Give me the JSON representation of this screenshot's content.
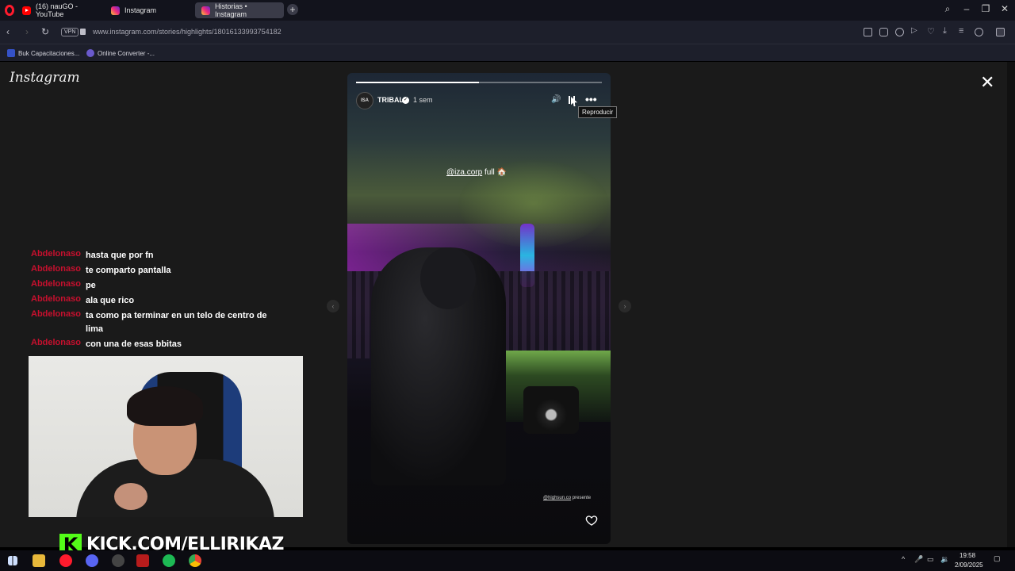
{
  "browser": {
    "tabs": [
      {
        "label": "(16) nauGO - YouTube",
        "icon": "youtube-icon",
        "active": false
      },
      {
        "label": "Instagram",
        "icon": "instagram-icon",
        "active": false
      },
      {
        "label": "Historias • Instagram",
        "icon": "instagram-icon",
        "active": true
      }
    ],
    "vpn_label": "VPN",
    "url": "www.instagram.com/stories/highlights/18016133993754182",
    "bookmarks": [
      {
        "label": "Buk Capacitaciones..."
      },
      {
        "label": "Online Converter -..."
      }
    ]
  },
  "instagram": {
    "logo": "Instagram",
    "story": {
      "avatar_text": "ISA",
      "username": "TRIBAL",
      "time": "1 sem",
      "tooltip": "Reproducir",
      "mention": "@iza.corp",
      "mention_suffix": " full 🏠",
      "footer_mention": "@highsun.co",
      "footer_suffix": " presente",
      "progress": 0.5
    }
  },
  "stream": {
    "chat": [
      {
        "user": "Abdelonaso",
        "message": "hasta que por fn"
      },
      {
        "user": "Abdelonaso",
        "message": "te comparto pantalla"
      },
      {
        "user": "Abdelonaso",
        "message": "pe"
      },
      {
        "user": "Abdelonaso",
        "message": "ala que rico"
      },
      {
        "user": "Abdelonaso",
        "message": "ta como pa terminar en un telo de centro de lima"
      },
      {
        "user": "Abdelonaso",
        "message": "con una de esas bbitas"
      }
    ],
    "kick_badge": "K",
    "kick_url": "KICK.COM/ELLIRIKAZ"
  },
  "taskbar": {
    "time": "19:58",
    "date": "2/09/2025"
  },
  "colors": {
    "chat_user": "#c8102e",
    "kick_green": "#53fc18",
    "browser_bg": "#12131c"
  }
}
